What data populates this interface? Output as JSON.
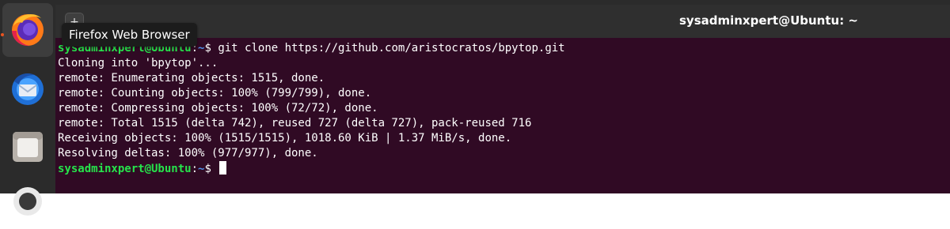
{
  "dock": {
    "items": [
      {
        "icon": "firefox-icon",
        "label": "Firefox Web Browser",
        "active": true
      },
      {
        "icon": "thunderbird-icon"
      },
      {
        "icon": "files-icon"
      },
      {
        "icon": "rhythmbox-icon"
      }
    ],
    "tooltip": "Firefox Web Browser"
  },
  "header": {
    "new_tab_symbol": "+",
    "title": "sysadminxpert@Ubuntu: ~"
  },
  "terminal": {
    "prompt_user": "sysadminxpert@Ubuntu",
    "prompt_sep": ":",
    "prompt_path": "~",
    "prompt_end": "$",
    "command": " git clone https://github.com/aristocratos/bpytop.git",
    "output": [
      "Cloning into 'bpytop'...",
      "remote: Enumerating objects: 1515, done.",
      "remote: Counting objects: 100% (799/799), done.",
      "remote: Compressing objects: 100% (72/72), done.",
      "remote: Total 1515 (delta 742), reused 727 (delta 727), pack-reused 716",
      "Receiving objects: 100% (1515/1515), 1018.60 KiB | 1.37 MiB/s, done.",
      "Resolving deltas: 100% (977/977), done."
    ]
  },
  "colors": {
    "terminal_bg": "#300a24",
    "prompt_user": "#26e34b",
    "prompt_path": "#4f8fe8",
    "accent": "#e95420"
  }
}
